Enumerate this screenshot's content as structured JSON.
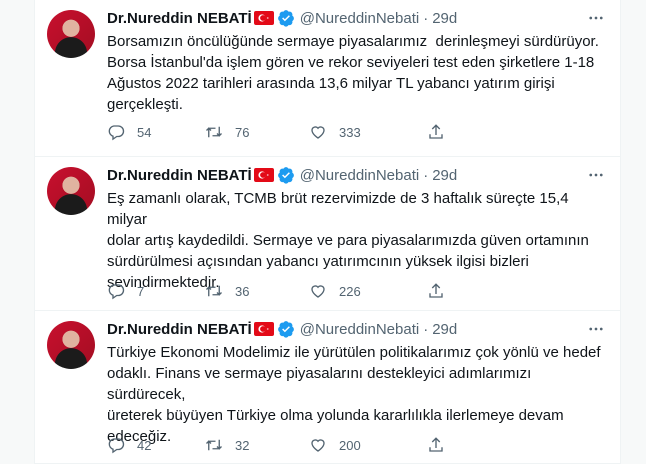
{
  "tweets": [
    {
      "name": "Dr.Nureddin NEBATİ",
      "handle": "@NureddinNebati",
      "separator": "·",
      "time": "29d",
      "text": "Borsamızın öncülüğünde sermaye piyasalarımız  derinleşmeyi sürdürüyor.\nBorsa İstanbul'da işlem gören ve rekor seviyeleri test eden şirketlere 1-18\nAğustos 2022 tarihleri arasında 13,6 milyar TL yabancı yatırım girişi\ngerçekleşti.",
      "replies": "54",
      "retweets": "76",
      "likes": "333"
    },
    {
      "name": "Dr.Nureddin NEBATİ",
      "handle": "@NureddinNebati",
      "separator": "·",
      "time": "29d",
      "text": "Eş zamanlı olarak, TCMB brüt rezervimizde de 3 haftalık süreçte 15,4 milyar\ndolar artış kaydedildi. Sermaye ve para piyasalarımızda güven ortamının\nsürdürülmesi açısından yabancı yatırımcının yüksek ilgisi bizleri\nsevindirmektedir.",
      "replies": "7",
      "retweets": "36",
      "likes": "226"
    },
    {
      "name": "Dr.Nureddin NEBATİ",
      "handle": "@NureddinNebati",
      "separator": "·",
      "time": "29d",
      "text": "Türkiye Ekonomi Modelimiz ile yürütülen politikalarımız çok yönlü ve hedef\nodaklı. Finans ve sermaye piyasalarını destekleyici adımlarımızı sürdürecek,\nüreterek büyüyen Türkiye olma yolunda kararlılıkla ilerlemeye devam\nedeceğiz.",
      "replies": "42",
      "retweets": "32",
      "likes": "200"
    }
  ],
  "colors": {
    "text": "#0f1419",
    "muted": "#536471",
    "verified": "#1d9bf0",
    "flag": "#e30a17"
  },
  "icons": [
    "more-icon",
    "verified-icon",
    "turkish-flag-icon",
    "reply-icon",
    "retweet-icon",
    "like-icon",
    "share-icon"
  ]
}
